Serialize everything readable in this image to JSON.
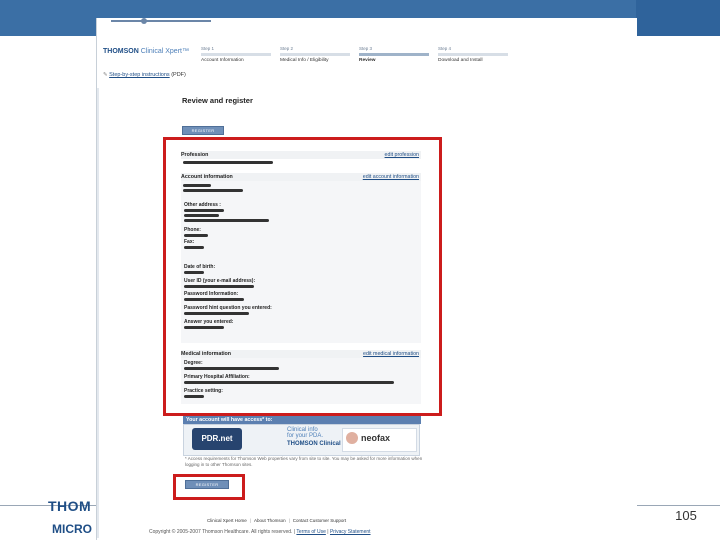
{
  "slide": {
    "page_number": "105",
    "logo_top": "THOM",
    "logo_bottom": "MICRO"
  },
  "app": {
    "brand": "THOMSON",
    "brand_sub": "Clinical Xpert",
    "brand_tm": "™",
    "steps": [
      {
        "step": "Step 1",
        "label": "Account Information",
        "active": false
      },
      {
        "step": "Step 2",
        "label": "Medical Info / Eligibility",
        "active": false
      },
      {
        "step": "Step 3",
        "label": "Review",
        "active": true
      },
      {
        "step": "Step 4",
        "label": "Download and Install",
        "active": false
      }
    ],
    "instructions_link": "Step-by-step instructions",
    "instructions_suffix": "(PDF)"
  },
  "review": {
    "title": "Review and register",
    "register_label": "REGISTER",
    "profession": {
      "label": "Profession",
      "edit": "edit profession"
    },
    "account": {
      "label": "Account information",
      "edit": "edit account information"
    },
    "fields": {
      "other_address": "Other address :",
      "phone": "Phone:",
      "fax": "Fax:",
      "dob": "Date of birth:",
      "user_id": "User ID (your e-mail address):",
      "password": "Password Information:",
      "password_hint": "Password hint question you entered:",
      "answer": "Answer you entered:"
    },
    "medical": {
      "label": "Medical information",
      "edit": "edit medical information"
    },
    "medical_fields": {
      "degree": "Degree:",
      "affiliation": "Primary Hospital Affiliation:",
      "setting": "Practice setting:"
    }
  },
  "access": {
    "heading": "Your account will have access* to:",
    "pdr_label": "PDR.net",
    "clinical_line1": "Clinical info",
    "clinical_line2": "for your PDA.",
    "clinical_brand": "THOMSON Clinical Xpert",
    "neofax": "neofax",
    "footnote": "* Access requirements for Thomson Web properties vary from site to site. You may be asked for more information when logging in to other Thomson sites."
  },
  "footer": {
    "links": [
      "Clinical Xpert Home",
      "About Thomson",
      "Contact Customer Support"
    ],
    "copyright": "Copyright © 2005-2007 Thomson Healthcare. All rights reserved.",
    "terms": "Terms of Use",
    "privacy": "Privacy Statement"
  },
  "colors": {
    "accent": "#3b6fa5",
    "highlight": "#cc1c1c",
    "button": "#6f8fb8"
  }
}
